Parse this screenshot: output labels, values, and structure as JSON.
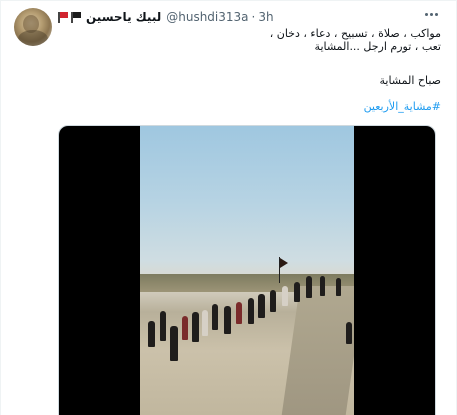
{
  "tweet": {
    "display_name": "لبيك ياحسين",
    "handle": "@hushdi313a",
    "separator": "·",
    "time": "3h",
    "flags": [
      "black-flag",
      "red-flag"
    ],
    "text_lines": [
      "مواكب ، صلاة ، تسبيح ، دعاء ، دخان ،",
      "تعب ، تورم ارجل ...المشاية"
    ],
    "greeting": "صباح المشاية",
    "hashtag": "#مشاية_الأربعين"
  },
  "media": {
    "type": "video",
    "scene": "pilgrims-walking"
  },
  "icons": {
    "more": "more-horizontal-icon",
    "avatar": "avatar"
  },
  "colors": {
    "text": "#0f1419",
    "secondary": "#536471",
    "link": "#1d9bf0",
    "border": "#eff3f4"
  }
}
